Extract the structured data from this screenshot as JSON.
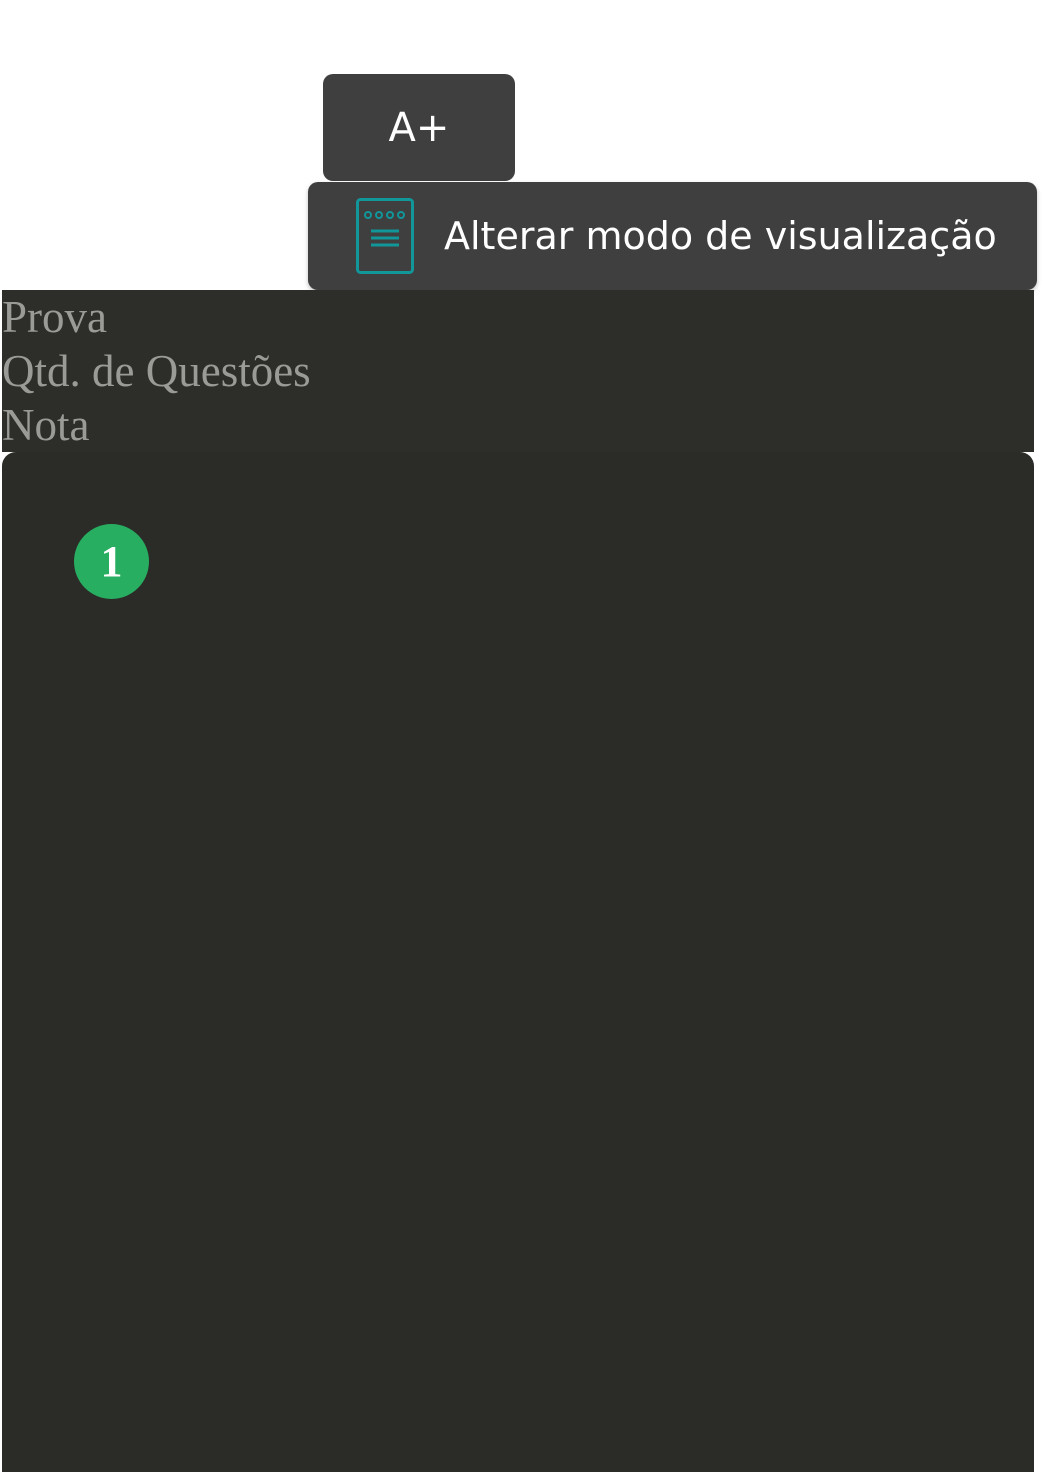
{
  "toolbar": {
    "font_size_label": "A+",
    "view_mode_label": "Alterar modo de visualização",
    "view_mode_icon": "document-list-icon",
    "accent_color": "#11969a",
    "button_bg": "#3f3f3f"
  },
  "header": {
    "lines": [
      "Prova",
      "Qtd. de Questões",
      "Nota"
    ]
  },
  "content": {
    "question_number": "1",
    "badge_color": "#27ae60"
  }
}
